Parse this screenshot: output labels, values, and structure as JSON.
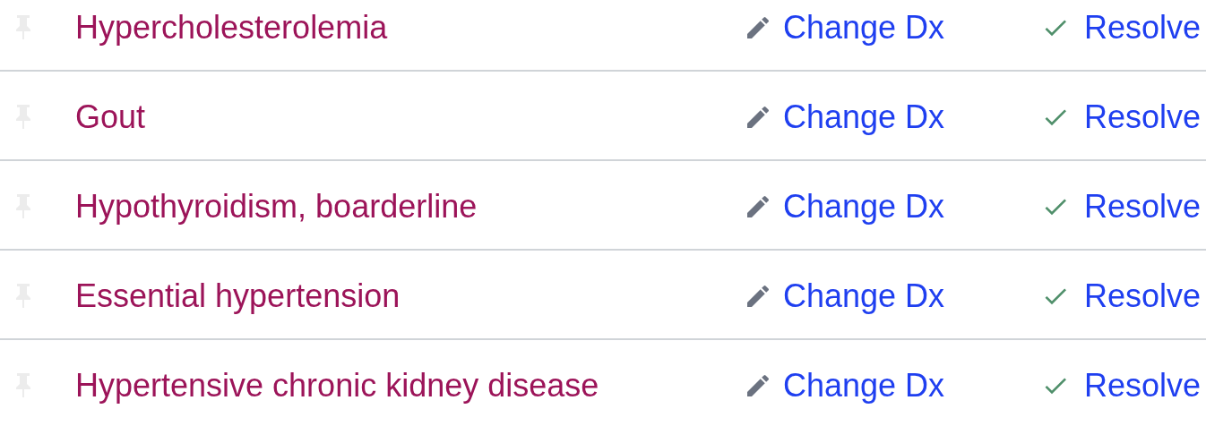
{
  "problems": [
    {
      "name": "Hypercholesterolemia",
      "pinned": false,
      "change_label": "Change Dx",
      "resolve_label": "Resolve"
    },
    {
      "name": "Gout",
      "pinned": false,
      "change_label": "Change Dx",
      "resolve_label": "Resolve"
    },
    {
      "name": "Hypothyroidism, boarderline",
      "pinned": false,
      "change_label": "Change Dx",
      "resolve_label": "Resolve"
    },
    {
      "name": "Essential hypertension",
      "pinned": false,
      "change_label": "Change Dx",
      "resolve_label": "Resolve"
    },
    {
      "name": "Hypertensive chronic kidney disease",
      "pinned": false,
      "change_label": "Change Dx",
      "resolve_label": "Resolve"
    }
  ]
}
